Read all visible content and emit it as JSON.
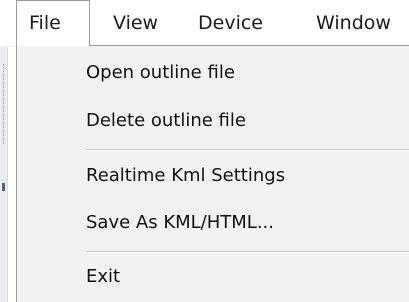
{
  "menubar": {
    "items": [
      {
        "label": "File",
        "active": true
      },
      {
        "label": "View"
      },
      {
        "label": "Device"
      },
      {
        "label": "Window"
      }
    ]
  },
  "file_menu": {
    "items": [
      {
        "label": "Open outline file"
      },
      {
        "label": "Delete outline file"
      },
      {
        "separator": true
      },
      {
        "label": "Realtime Kml Settings"
      },
      {
        "label": "Save As KML/HTML..."
      },
      {
        "separator": true
      },
      {
        "label": "Exit"
      }
    ]
  }
}
